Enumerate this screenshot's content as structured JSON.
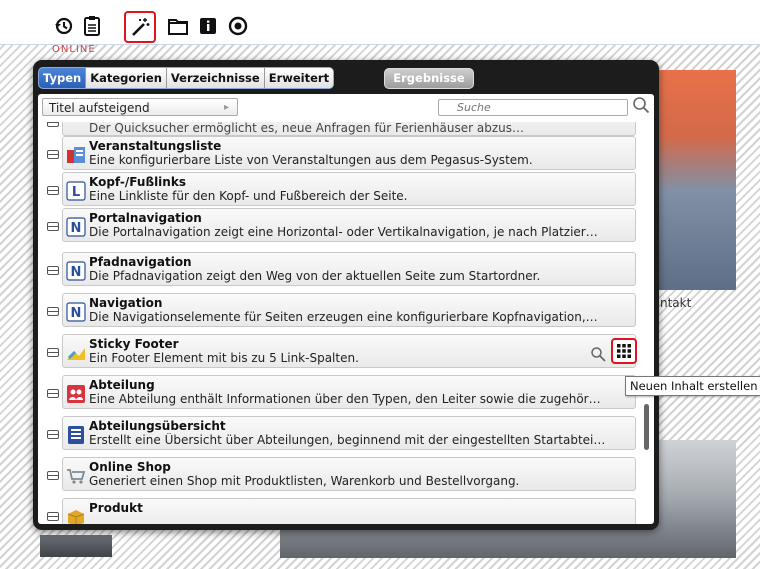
{
  "toolbar": {
    "icons": [
      "history-icon",
      "clipboard-icon",
      "magic-wand-icon",
      "folder-icon",
      "info-icon",
      "target-icon"
    ]
  },
  "background": {
    "online_label": "ONLINE",
    "kontakt_label": "ntakt"
  },
  "tabs": [
    {
      "label": "Typen",
      "active": true
    },
    {
      "label": "Kategorien",
      "active": false
    },
    {
      "label": "Verzeichnisse",
      "active": false
    },
    {
      "label": "Erweitert",
      "active": false
    }
  ],
  "results_button": "Ergebnisse",
  "sort": {
    "value": "Titel aufsteigend"
  },
  "search": {
    "placeholder": "Suche"
  },
  "partial_item_text": "Der Quicksucher ermöglicht es, neue Anfragen für Ferienhäuser abzus…",
  "items": [
    {
      "title": "Veranstaltungsliste",
      "desc": "Eine konfigurierbare Liste von Veranstaltungen aus dem Pegasus-System.",
      "icon": "event-list-icon"
    },
    {
      "title": "Kopf-/Fußlinks",
      "desc": "Eine Linkliste für den Kopf- und Fußbereich der Seite.",
      "icon": "link-l-icon"
    },
    {
      "title": "Portalnavigation",
      "desc": "Die Portalnavigation zeigt eine Horizontal- oder Vertikalnavigation, je nach Platzier…",
      "icon": "nav-n-icon"
    },
    {
      "title": "Pfadnavigation",
      "desc": "Die Pfadnavigation zeigt den Weg von der aktuellen Seite zum Startordner.",
      "icon": "nav-n-icon"
    },
    {
      "title": "Navigation",
      "desc": "Die Navigationselemente für Seiten erzeugen eine konfigurierbare Kopfnavigation,…",
      "icon": "nav-n-icon"
    },
    {
      "title": "Sticky Footer",
      "desc": "Ein Footer Element mit bis zu 5 Link-Spalten.",
      "icon": "sticky-footer-icon"
    },
    {
      "title": "Abteilung",
      "desc": "Eine Abteilung enthält Informationen über den Typen, den Leiter sowie die zugehör…",
      "icon": "department-icon"
    },
    {
      "title": "Abteilungsübersicht",
      "desc": "Erstellt eine Übersicht über Abteilungen, beginnend mit der eingestellten Startabtei…",
      "icon": "department-overview-icon"
    },
    {
      "title": "Online Shop",
      "desc": "Generiert einen Shop mit Produktlisten, Warenkorb und Bestellvorgang.",
      "icon": "shop-cart-icon"
    },
    {
      "title": "Produkt",
      "desc": "",
      "icon": "product-box-icon"
    }
  ],
  "tooltip": "Neuen Inhalt erstellen",
  "colors": {
    "accent": "#2a5fb8",
    "highlight": "#e0141c"
  }
}
